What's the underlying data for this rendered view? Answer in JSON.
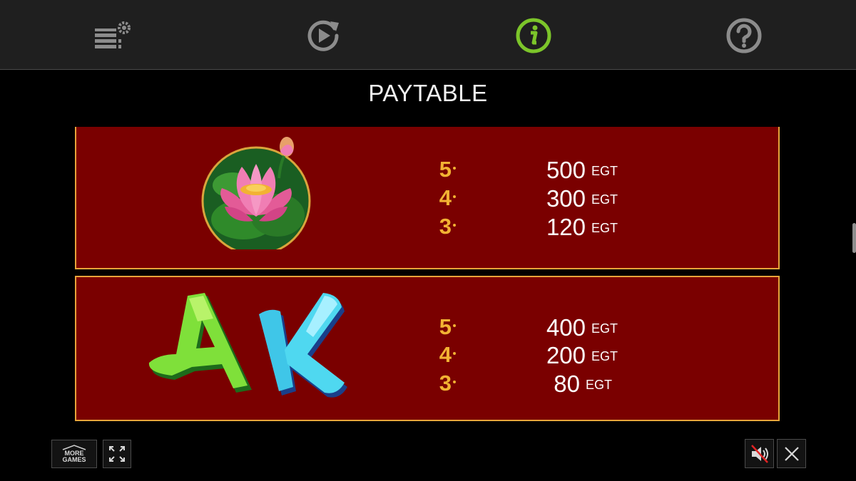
{
  "toolbar": {
    "items": [
      {
        "name": "settings",
        "icon": "stack-gear-icon",
        "active": false
      },
      {
        "name": "autoplay",
        "icon": "replay-icon",
        "active": false
      },
      {
        "name": "info",
        "icon": "info-icon",
        "active": true
      },
      {
        "name": "help",
        "icon": "help-icon",
        "active": false
      }
    ],
    "active_color": "#7cc52a",
    "icon_color": "#8c8c8c"
  },
  "title": "PAYTABLE",
  "paytable": [
    {
      "symbol": "lotus-flower",
      "rows": [
        {
          "count": "5",
          "amount": "500",
          "unit": "EGT"
        },
        {
          "count": "4",
          "amount": "300",
          "unit": "EGT"
        },
        {
          "count": "3",
          "amount": "120",
          "unit": "EGT"
        }
      ]
    },
    {
      "symbol": "A and K",
      "rows": [
        {
          "count": "5",
          "amount": "400",
          "unit": "EGT"
        },
        {
          "count": "4",
          "amount": "200",
          "unit": "EGT"
        },
        {
          "count": "3",
          "amount": "80",
          "unit": "EGT"
        }
      ]
    }
  ],
  "footer": {
    "more_games_line1": "MORE",
    "more_games_line2": "GAMES",
    "fullscreen_icon": "fullscreen-icon",
    "sound_icon": "speaker-muted-icon",
    "close_icon": "close-icon"
  },
  "colors": {
    "panel_bg": "#7a0000",
    "panel_border": "#e7a43a",
    "count_color": "#f2b233"
  }
}
